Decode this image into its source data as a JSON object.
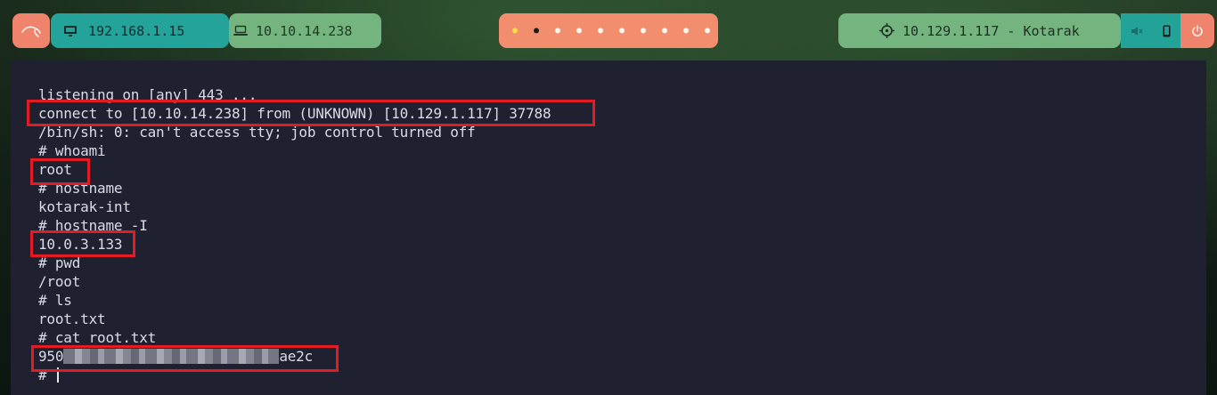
{
  "topbar": {
    "logo_icon": "kali-dragon-icon",
    "local_ip": {
      "icon": "monitor-icon",
      "text": "192.168.1.15"
    },
    "vpn_ip": {
      "icon": "laptop-icon",
      "text": "10.10.14.238"
    },
    "workspaces": {
      "count": 10,
      "active_index": 0,
      "current_index": 1
    },
    "target": {
      "icon": "crosshair-icon",
      "text": "10.129.1.117 - Kotarak"
    },
    "mute_icon": "speaker-muted-icon",
    "phone_icon": "phone-icon",
    "power_icon": "power-icon",
    "colors": {
      "salmon": "#f0836c",
      "teal": "#24a39a",
      "green": "#74b47f"
    }
  },
  "terminal": {
    "background": "#1f2030",
    "lines": [
      "listening on [any] 443 ...",
      "connect to [10.10.14.238] from (UNKNOWN) [10.129.1.117] 37788",
      "/bin/sh: 0: can't access tty; job control turned off",
      "# whoami",
      "root",
      "# hostname",
      "kotarak-int",
      "# hostname -I",
      "10.0.3.133",
      "# pwd",
      "/root",
      "# ls",
      "root.txt",
      "# cat root.txt"
    ],
    "flag_prefix": "950",
    "flag_suffix": "ae2c",
    "prompt": "# ",
    "highlight_color": "#e21c22"
  }
}
